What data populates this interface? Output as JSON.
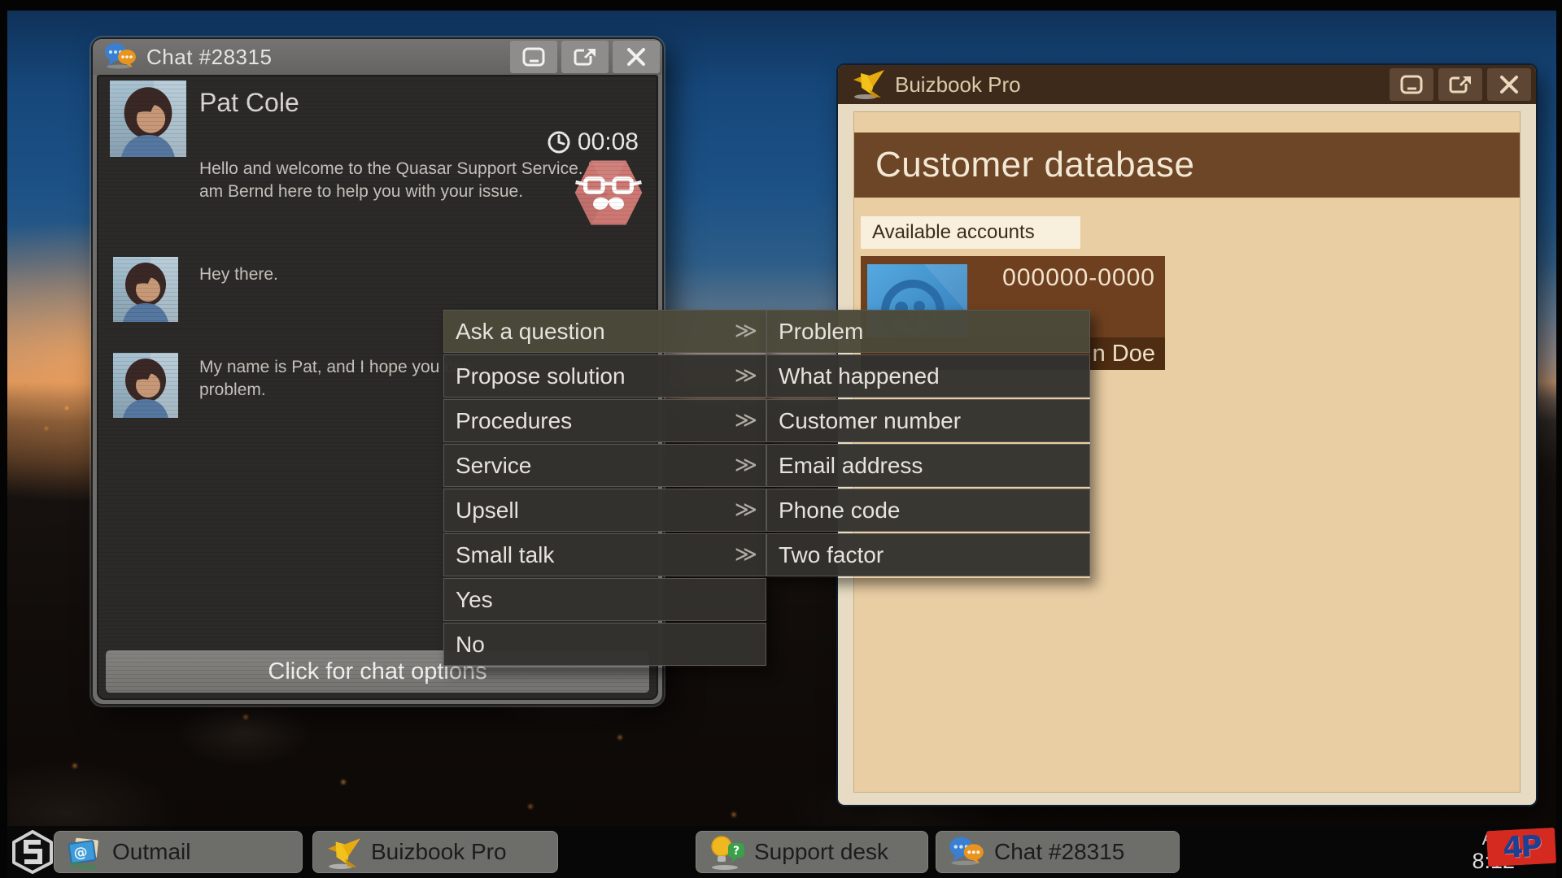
{
  "chat": {
    "title": "Chat #28315",
    "contact_name": "Pat Cole",
    "timer": "00:08",
    "messages": [
      {
        "sender": "agent",
        "text": "Hello and welcome to the Quasar Support Service. I am Bernd here to help you with your issue."
      },
      {
        "sender": "customer",
        "text": "Hey there."
      },
      {
        "sender": "customer",
        "line1": "My name is Pat, and I hope you can",
        "line2": "problem."
      }
    ],
    "footer_hint": "Click for chat options"
  },
  "menu": {
    "chevron_glyph": "≫",
    "items": [
      {
        "label": "Ask a question",
        "has_submenu": true,
        "selected": true
      },
      {
        "label": "Propose solution",
        "has_submenu": true
      },
      {
        "label": "Procedures",
        "has_submenu": true
      },
      {
        "label": "Service",
        "has_submenu": true
      },
      {
        "label": "Upsell",
        "has_submenu": true
      },
      {
        "label": "Small talk",
        "has_submenu": true
      },
      {
        "label": "Yes"
      },
      {
        "label": "No"
      }
    ],
    "submenu": [
      {
        "label": "Problem",
        "selected": true
      },
      {
        "label": "What happened"
      },
      {
        "label": "Customer number"
      },
      {
        "label": "Email address"
      },
      {
        "label": "Phone code"
      },
      {
        "label": "Two factor"
      }
    ]
  },
  "buizbook": {
    "title": "Buizbook Pro",
    "heading": "Customer database",
    "section_label": "Available accounts",
    "account": {
      "number": "000000-0000",
      "name_partial": "n Doe"
    }
  },
  "taskbar": {
    "items": [
      {
        "label": "Outmail"
      },
      {
        "label": "Buizbook Pro"
      },
      {
        "label": "Support desk"
      },
      {
        "label": "Chat #28315"
      }
    ],
    "clock_date": "Au",
    "clock_time": "8:12",
    "watermark": "4P"
  },
  "colors": {
    "menu_selected": "#4b493a",
    "buizbook_titlebar": "#3e2a1a",
    "buizbook_band": "#6d4628",
    "buizbook_panel": "#e9cda3",
    "chat_body": "#2b2a28",
    "agent_avatar": "#ce7873",
    "sunset_accent": "#e8a050"
  }
}
